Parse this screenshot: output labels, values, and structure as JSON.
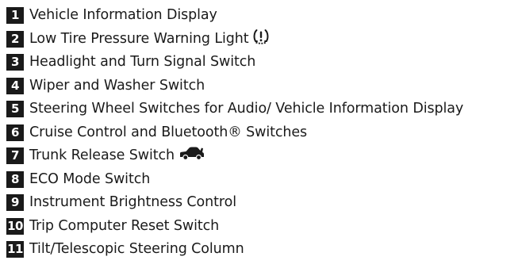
{
  "legend": {
    "items": [
      {
        "number": "1",
        "label": "Vehicle Information Display"
      },
      {
        "number": "2",
        "label": "Low Tire Pressure Warning Light",
        "icon": "tire-pressure-warning-icon"
      },
      {
        "number": "3",
        "label": "Headlight and Turn Signal Switch"
      },
      {
        "number": "4",
        "label": "Wiper and Washer Switch"
      },
      {
        "number": "5",
        "label": "Steering Wheel Switches for Audio/ Vehicle Information Display"
      },
      {
        "number": "6",
        "label": "Cruise Control and Bluetooth® Switches"
      },
      {
        "number": "7",
        "label": "Trunk Release Switch",
        "icon": "trunk-release-car-icon"
      },
      {
        "number": "8",
        "label": "ECO Mode Switch"
      },
      {
        "number": "9",
        "label": "Instrument Brightness Control"
      },
      {
        "number": "10",
        "label": "Trip Computer Reset Switch"
      },
      {
        "number": "11",
        "label": "Tilt/Telescopic Steering Column"
      }
    ]
  },
  "colors": {
    "badge_background": "#1a1a1a",
    "badge_text": "#ffffff",
    "text": "#1a1a1a"
  }
}
